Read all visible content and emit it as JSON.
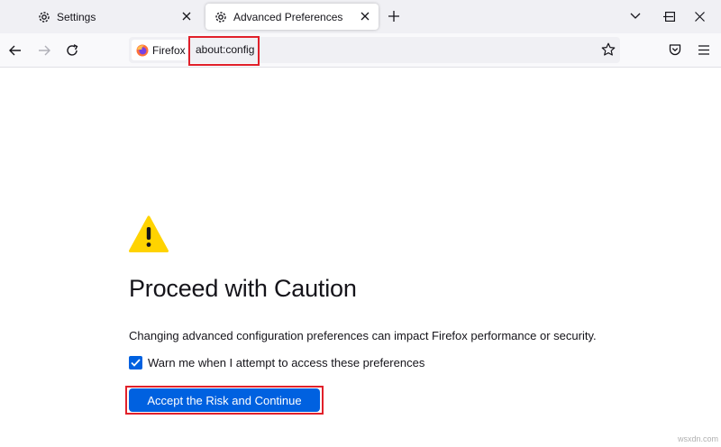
{
  "tabs": [
    {
      "title": "Settings",
      "icon": "gear-icon"
    },
    {
      "title": "Advanced Preferences",
      "icon": "gear-icon",
      "active": true
    }
  ],
  "toolbar": {
    "identity_label": "Firefox",
    "url": "about:config"
  },
  "page": {
    "heading": "Proceed with Caution",
    "description": "Changing advanced configuration preferences can impact Firefox performance or security.",
    "checkbox_label": "Warn me when I attempt to access these preferences",
    "checkbox_checked": true,
    "button_label": "Accept the Risk and Continue"
  },
  "watermark": "wsxdn.com",
  "colors": {
    "accent": "#0061e0",
    "warning": "#ffd300",
    "highlight": "#e1202a"
  }
}
